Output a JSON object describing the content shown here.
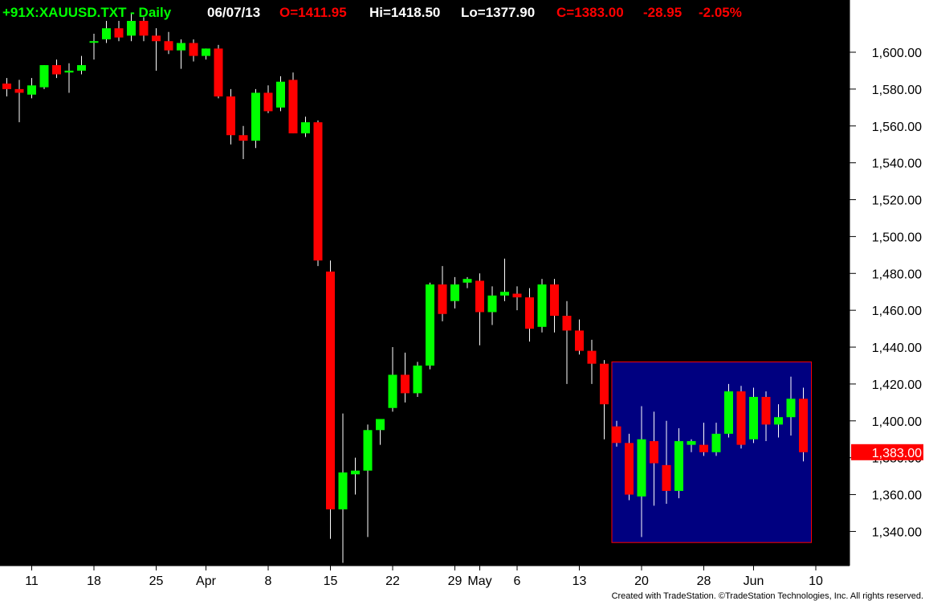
{
  "header": {
    "symbol": "+91X:XAUUSD.TXT - Daily",
    "date": "06/07/13",
    "open": "O=1411.95",
    "high": "Hi=1418.50",
    "low": "Lo=1377.90",
    "close": "C=1383.00",
    "change": "-28.95",
    "change_pct": "-2.05%"
  },
  "footer": {
    "credit": "Created with TradeStation. ©TradeStation Technologies, Inc. All rights reserved."
  },
  "last_price_label": "1,383.00",
  "colors": {
    "up": "#00ff00",
    "down": "#ff0000",
    "background": "#000000",
    "axis_panel": "#ffffff",
    "highlight_box": "#000080",
    "header_symbol": "#00ff00",
    "header_date": "#ffffff",
    "header_values": "#ff0000"
  },
  "chart_data": {
    "type": "candlestick",
    "ylim": [
      1320,
      1620
    ],
    "y_ticks": [
      {
        "value": 1340,
        "label": "1,340.00"
      },
      {
        "value": 1360,
        "label": "1,360.00"
      },
      {
        "value": 1380,
        "label": "1,380.00"
      },
      {
        "value": 1400,
        "label": "1,400.00"
      },
      {
        "value": 1420,
        "label": "1,420.00"
      },
      {
        "value": 1440,
        "label": "1,440.00"
      },
      {
        "value": 1460,
        "label": "1,460.00"
      },
      {
        "value": 1480,
        "label": "1,480.00"
      },
      {
        "value": 1500,
        "label": "1,500.00"
      },
      {
        "value": 1520,
        "label": "1,520.00"
      },
      {
        "value": 1540,
        "label": "1,540.00"
      },
      {
        "value": 1560,
        "label": "1,560.00"
      },
      {
        "value": 1580,
        "label": "1,580.00"
      },
      {
        "value": 1600,
        "label": "1,600.00"
      }
    ],
    "x_ticks": [
      {
        "label": "11",
        "bar": 2
      },
      {
        "label": "18",
        "bar": 7
      },
      {
        "label": "25",
        "bar": 12
      },
      {
        "label": "Apr",
        "bar": 16
      },
      {
        "label": "8",
        "bar": 21
      },
      {
        "label": "15",
        "bar": 26
      },
      {
        "label": "22",
        "bar": 31
      },
      {
        "label": "29",
        "bar": 36
      },
      {
        "label": "May",
        "bar": 38
      },
      {
        "label": "6",
        "bar": 41
      },
      {
        "label": "13",
        "bar": 46
      },
      {
        "label": "20",
        "bar": 51
      },
      {
        "label": "28",
        "bar": 56
      },
      {
        "label": "Jun",
        "bar": 60
      },
      {
        "label": "10",
        "bar": 65
      }
    ],
    "highlight_range": {
      "from_bar": 49,
      "to_bar": 64,
      "y_low": 1334,
      "y_high": 1432
    },
    "last_close": 1383.0,
    "candles": [
      {
        "o": 1583,
        "h": 1586,
        "l": 1576,
        "c": 1580
      },
      {
        "o": 1580,
        "h": 1585,
        "l": 1562,
        "c": 1578
      },
      {
        "o": 1577,
        "h": 1586,
        "l": 1575,
        "c": 1582
      },
      {
        "o": 1581,
        "h": 1593,
        "l": 1580,
        "c": 1593
      },
      {
        "o": 1593,
        "h": 1596,
        "l": 1586,
        "c": 1588
      },
      {
        "o": 1589,
        "h": 1594,
        "l": 1578,
        "c": 1590
      },
      {
        "o": 1590,
        "h": 1598,
        "l": 1588,
        "c": 1593
      },
      {
        "o": 1606,
        "h": 1610,
        "l": 1596,
        "c": 1606
      },
      {
        "o": 1607,
        "h": 1617,
        "l": 1605,
        "c": 1613
      },
      {
        "o": 1613,
        "h": 1617,
        "l": 1606,
        "c": 1608
      },
      {
        "o": 1609,
        "h": 1621,
        "l": 1606,
        "c": 1617
      },
      {
        "o": 1617,
        "h": 1619,
        "l": 1606,
        "c": 1609
      },
      {
        "o": 1609,
        "h": 1613,
        "l": 1590,
        "c": 1606
      },
      {
        "o": 1606,
        "h": 1611,
        "l": 1599,
        "c": 1601
      },
      {
        "o": 1601,
        "h": 1607,
        "l": 1591,
        "c": 1605
      },
      {
        "o": 1605,
        "h": 1607,
        "l": 1595,
        "c": 1598
      },
      {
        "o": 1598,
        "h": 1602,
        "l": 1596,
        "c": 1602
      },
      {
        "o": 1602,
        "h": 1604,
        "l": 1575,
        "c": 1576
      },
      {
        "o": 1576,
        "h": 1580,
        "l": 1550,
        "c": 1555
      },
      {
        "o": 1555,
        "h": 1560,
        "l": 1542,
        "c": 1552
      },
      {
        "o": 1552,
        "h": 1580,
        "l": 1548,
        "c": 1578
      },
      {
        "o": 1578,
        "h": 1582,
        "l": 1567,
        "c": 1568
      },
      {
        "o": 1570,
        "h": 1587,
        "l": 1568,
        "c": 1584
      },
      {
        "o": 1585,
        "h": 1589,
        "l": 1556,
        "c": 1556
      },
      {
        "o": 1556,
        "h": 1565,
        "l": 1554,
        "c": 1562
      },
      {
        "o": 1562,
        "h": 1563,
        "l": 1484,
        "c": 1487
      },
      {
        "o": 1481,
        "h": 1487,
        "l": 1336,
        "c": 1352
      },
      {
        "o": 1352,
        "h": 1404,
        "l": 1323,
        "c": 1372
      },
      {
        "o": 1371,
        "h": 1380,
        "l": 1360,
        "c": 1373
      },
      {
        "o": 1373,
        "h": 1398,
        "l": 1337,
        "c": 1395
      },
      {
        "o": 1395,
        "h": 1400,
        "l": 1387,
        "c": 1401
      },
      {
        "o": 1407,
        "h": 1440,
        "l": 1405,
        "c": 1425
      },
      {
        "o": 1425,
        "h": 1437,
        "l": 1410,
        "c": 1415
      },
      {
        "o": 1415,
        "h": 1432,
        "l": 1413,
        "c": 1430
      },
      {
        "o": 1430,
        "h": 1475,
        "l": 1428,
        "c": 1474
      },
      {
        "o": 1474,
        "h": 1484,
        "l": 1454,
        "c": 1458
      },
      {
        "o": 1465,
        "h": 1478,
        "l": 1461,
        "c": 1474
      },
      {
        "o": 1475,
        "h": 1478,
        "l": 1472,
        "c": 1477
      },
      {
        "o": 1476,
        "h": 1480,
        "l": 1441,
        "c": 1459
      },
      {
        "o": 1459,
        "h": 1473,
        "l": 1452,
        "c": 1468
      },
      {
        "o": 1468,
        "h": 1488,
        "l": 1465,
        "c": 1470
      },
      {
        "o": 1469,
        "h": 1473,
        "l": 1460,
        "c": 1467
      },
      {
        "o": 1467,
        "h": 1472,
        "l": 1443,
        "c": 1450
      },
      {
        "o": 1451,
        "h": 1477,
        "l": 1448,
        "c": 1474
      },
      {
        "o": 1474,
        "h": 1477,
        "l": 1448,
        "c": 1457
      },
      {
        "o": 1457,
        "h": 1465,
        "l": 1420,
        "c": 1449
      },
      {
        "o": 1449,
        "h": 1455,
        "l": 1436,
        "c": 1438
      },
      {
        "o": 1438,
        "h": 1444,
        "l": 1420,
        "c": 1431
      },
      {
        "o": 1431,
        "h": 1433,
        "l": 1390,
        "c": 1409
      },
      {
        "o": 1397,
        "h": 1400,
        "l": 1386,
        "c": 1388
      },
      {
        "o": 1388,
        "h": 1393,
        "l": 1357,
        "c": 1360
      },
      {
        "o": 1359,
        "h": 1408,
        "l": 1337,
        "c": 1390
      },
      {
        "o": 1389,
        "h": 1405,
        "l": 1354,
        "c": 1377
      },
      {
        "o": 1376,
        "h": 1400,
        "l": 1355,
        "c": 1362
      },
      {
        "o": 1362,
        "h": 1396,
        "l": 1358,
        "c": 1389
      },
      {
        "o": 1387,
        "h": 1390,
        "l": 1383,
        "c": 1389
      },
      {
        "o": 1387,
        "h": 1399,
        "l": 1381,
        "c": 1383
      },
      {
        "o": 1383,
        "h": 1399,
        "l": 1381,
        "c": 1393
      },
      {
        "o": 1393,
        "h": 1420,
        "l": 1391,
        "c": 1416
      },
      {
        "o": 1416,
        "h": 1419,
        "l": 1385,
        "c": 1387
      },
      {
        "o": 1390,
        "h": 1418,
        "l": 1388,
        "c": 1413
      },
      {
        "o": 1413,
        "h": 1416,
        "l": 1389,
        "c": 1398
      },
      {
        "o": 1398,
        "h": 1409,
        "l": 1391,
        "c": 1402
      },
      {
        "o": 1402,
        "h": 1424,
        "l": 1392,
        "c": 1412
      },
      {
        "o": 1412,
        "h": 1418,
        "l": 1378,
        "c": 1383
      }
    ]
  }
}
